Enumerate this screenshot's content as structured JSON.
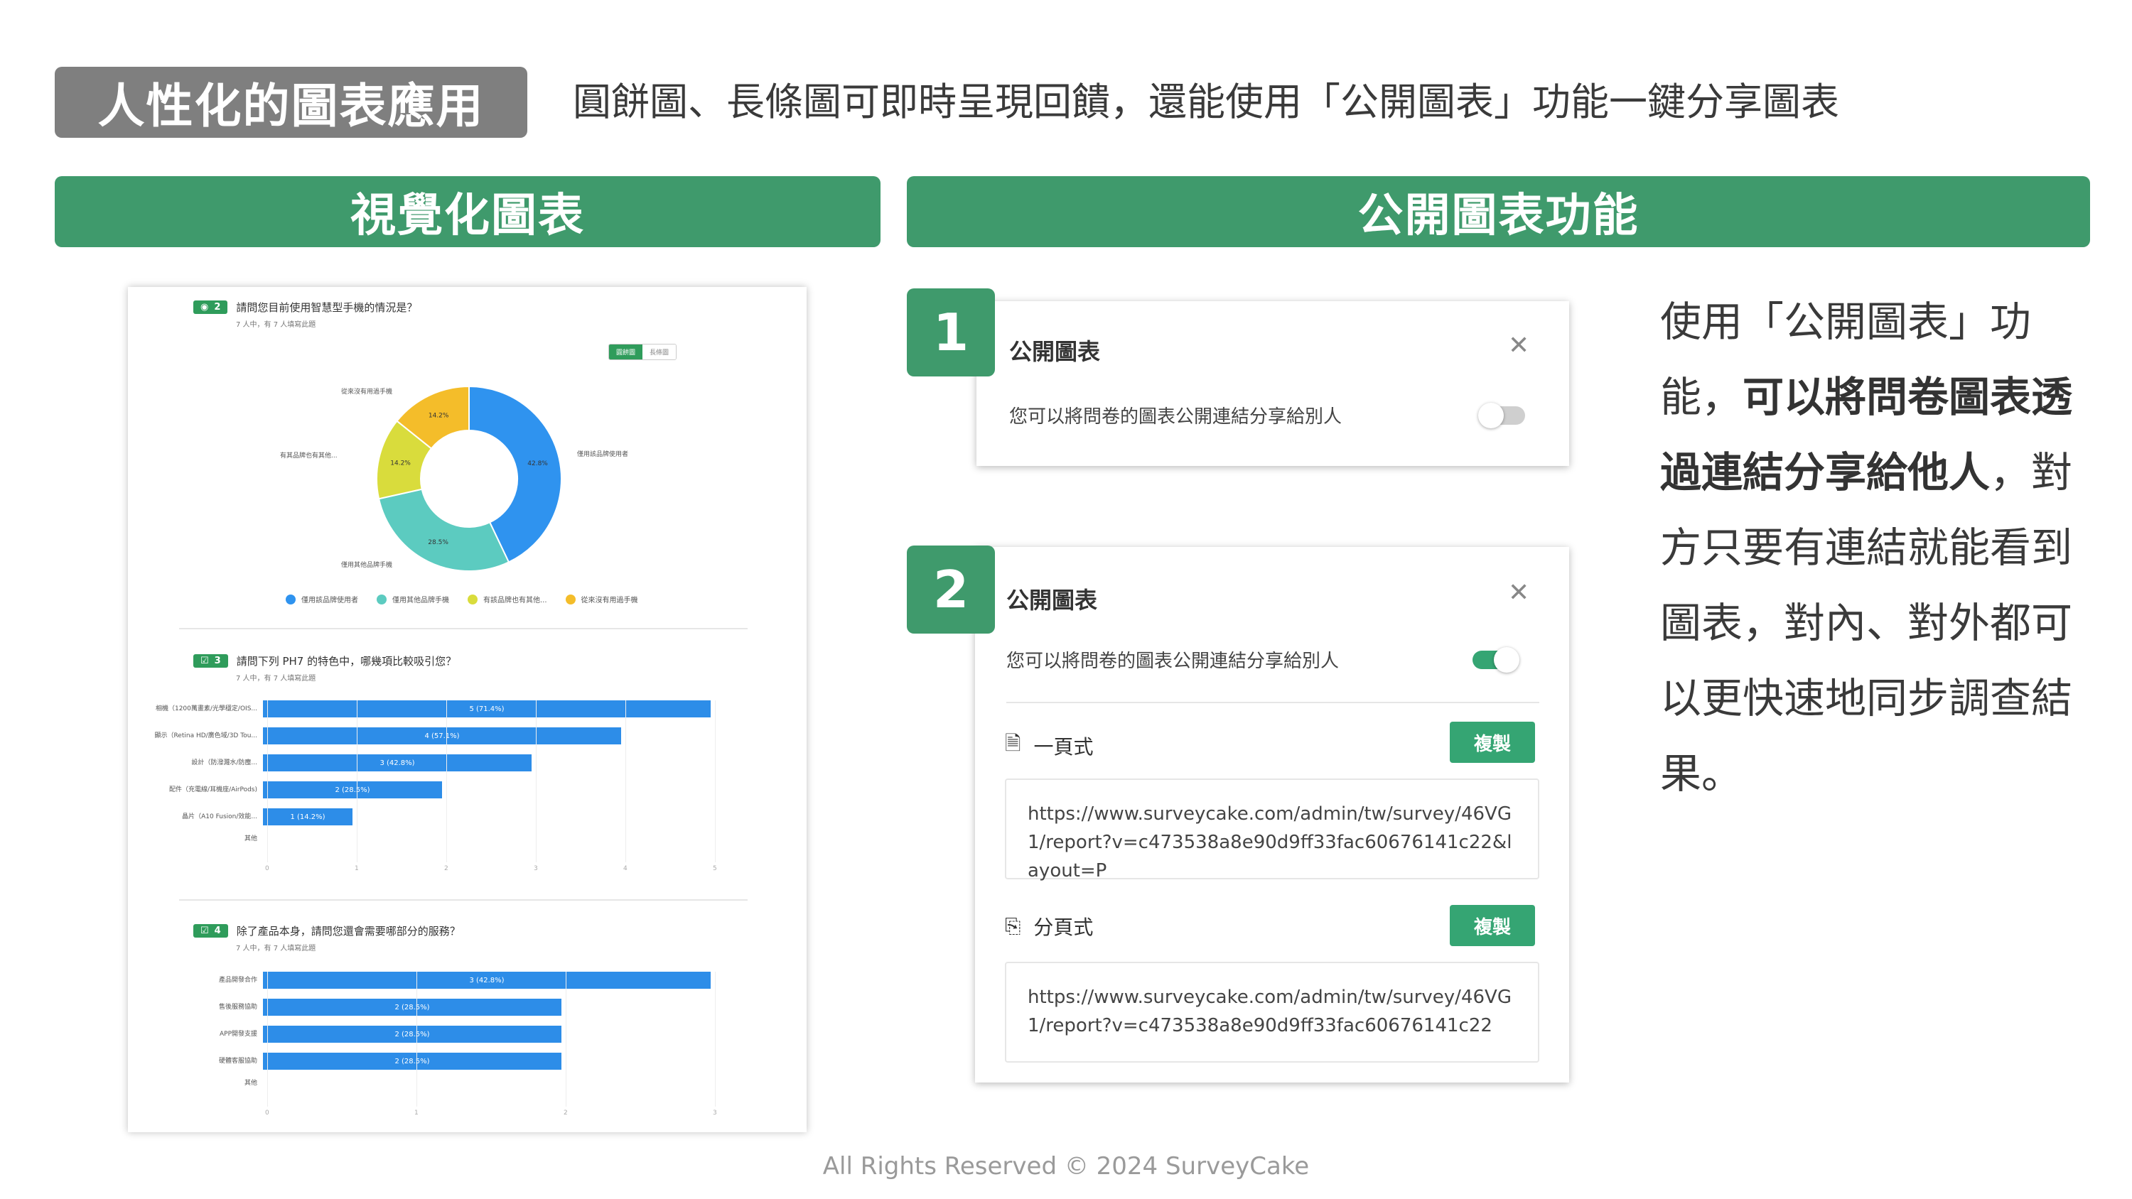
{
  "header": {
    "tag": "人性化的圖表應用",
    "subtitle": "圓餅圖、長條圖可即時呈現回饋，還能使用「公開圖表」功能一鍵分享圖表"
  },
  "sections": {
    "left": "視覺化圖表",
    "right": "公開圖表功能"
  },
  "report": {
    "q2": {
      "badge_num": "2",
      "title": "請問您目前使用智慧型手機的情況是？",
      "sub": "7 人中，有 7 人填寫此題",
      "toggle_on": "圓餅圖",
      "toggle_off": "長條圖",
      "labels": [
        "從來沒有用過手機",
        "有其品牌也有其他...",
        "僅用其他品牌手機",
        "僅用該品牌使用者"
      ],
      "legend": [
        "僅用該品牌使用者",
        "僅用其他品牌手機",
        "有該品牌也有其他...",
        "從來沒有用過手機"
      ]
    },
    "q3": {
      "badge_num": "3",
      "title": "請問下列 PH7 的特色中，哪幾項比較吸引您？",
      "sub": "7 人中，有 7 人填寫此題",
      "ticks": [
        "0",
        "1",
        "2",
        "3",
        "4",
        "5"
      ]
    },
    "q4": {
      "badge_num": "4",
      "title": "除了產品本身，請問您還會需要哪部分的服務？",
      "sub": "7 人中，有 7 人填寫此題",
      "ticks": [
        "0",
        "1",
        "2",
        "3"
      ]
    }
  },
  "chart_data": [
    {
      "type": "pie",
      "title": "請問您目前使用智慧型手機的情況是？",
      "categories": [
        "僅用該品牌使用者",
        "僅用其他品牌手機",
        "有該品牌也有其他...",
        "從來沒有用過手機"
      ],
      "values": [
        42.8,
        28.5,
        14.2,
        14.2
      ],
      "value_labels": [
        "42.8%",
        "28.5%",
        "14.2%",
        "14.2%"
      ],
      "colors": [
        "#2f93ef",
        "#5ccbc0",
        "#d9dc3c",
        "#f4bd2a"
      ],
      "legend": "bottom"
    },
    {
      "type": "bar",
      "orientation": "horizontal",
      "title": "請問下列 PH7 的特色中，哪幾項比較吸引您？",
      "categories": [
        "相機（1200萬畫素/光學穩定/OIS...",
        "顯示（Retina HD/廣色域/3D Tou...",
        "設計（防潑濺水/防塵...",
        "配件（充電線/耳機座/AirPods)",
        "晶片（A10 Fusion/效能...",
        "其他"
      ],
      "values": [
        5,
        4,
        3,
        2,
        1,
        0
      ],
      "value_labels": [
        "5 (71.4%)",
        "4 (57.1%)",
        "3 (42.8%)",
        "2 (28.5%)",
        "1 (14.2%)",
        ""
      ],
      "xlim": [
        0,
        5
      ],
      "color": "#2d8de8"
    },
    {
      "type": "bar",
      "orientation": "horizontal",
      "title": "除了產品本身，請問您還會需要哪部分的服務？",
      "categories": [
        "產品開發合作",
        "售後服務協助",
        "APP開發支援",
        "硬體客服協助",
        "其他"
      ],
      "values": [
        3,
        2,
        2,
        2,
        0
      ],
      "value_labels": [
        "3 (42.8%)",
        "2 (28.5%)",
        "2 (28.5%)",
        "2 (28.5%)",
        ""
      ],
      "xlim": [
        0,
        3
      ],
      "color": "#2d8de8"
    }
  ],
  "dialog1": {
    "num": "1",
    "title": "公開圖表",
    "desc": "您可以將問卷的圖表公開連結分享給別人",
    "toggle": "off"
  },
  "dialog2": {
    "num": "2",
    "title": "公開圖表",
    "desc": "您可以將問卷的圖表公開連結分享給別人",
    "toggle": "on",
    "single_label": "一頁式",
    "multi_label": "分頁式",
    "copy_label": "複製",
    "single_url": "https://www.surveycake.com/admin/tw/survey/46VG1/report?v=c473538a8e90d9ff33fac60676141c22&layout=P",
    "multi_url": "https://www.surveycake.com/admin/tw/survey/46VG1/report?v=c473538a8e90d9ff33fac60676141c22"
  },
  "description": {
    "part1": "使用「公開圖表」功能，",
    "bold": "可以將問卷圖表透過連結分享給他人",
    "part2": "，對方只要有連結就能看到圖表，對內、對外都可以更快速地同步調查結果。"
  },
  "footer": "All Rights Reserved © 2024 SurveyCake",
  "colors": {
    "accent_green": "#3f9a6c",
    "tag_gray": "#7f7f7f",
    "bar_blue": "#2d8de8",
    "toggle_on": "#35a573",
    "toggle_off": "#cfcfcf"
  }
}
